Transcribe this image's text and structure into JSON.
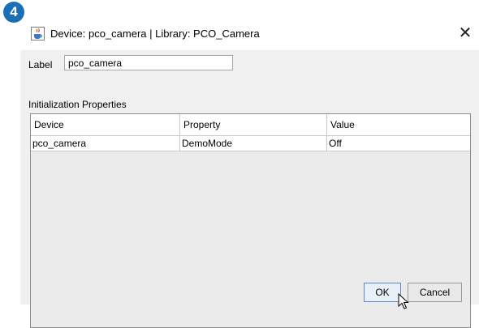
{
  "step_badge": "4",
  "window": {
    "title": "Device: pco_camera | Library: PCO_Camera",
    "close_symbol": "✕",
    "icon": "java-cup-icon"
  },
  "form": {
    "label_caption": "Label",
    "label_value": "pco_camera"
  },
  "init_props": {
    "title": "Initialization Properties",
    "columns": [
      "Device",
      "Property",
      "Value"
    ],
    "rows": [
      [
        "pco_camera",
        "DemoMode",
        "Off"
      ]
    ]
  },
  "buttons": {
    "ok": "OK",
    "cancel": "Cancel"
  }
}
